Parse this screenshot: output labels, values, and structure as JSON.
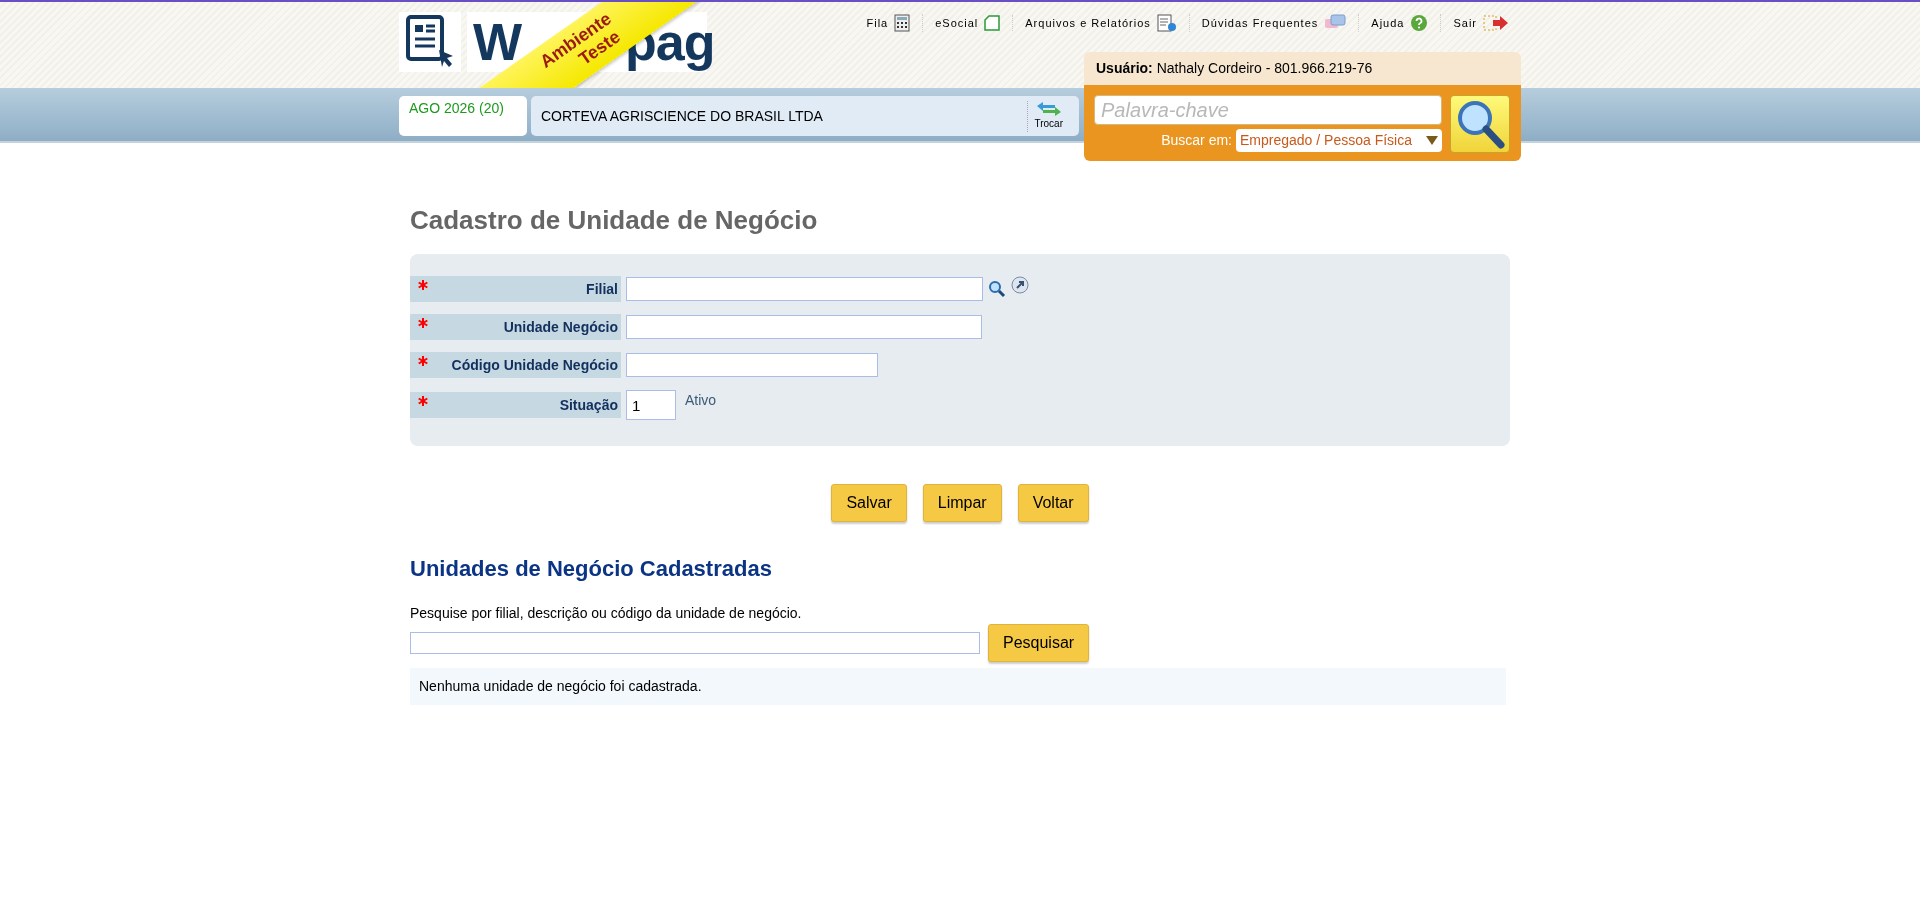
{
  "logo": {
    "parts": [
      "W",
      "pag"
    ]
  },
  "ribbon": {
    "lines": [
      "Ambiente",
      "Teste"
    ]
  },
  "top_nav": [
    {
      "label": "Fila",
      "kind": "calculator"
    },
    {
      "label": "eSocial",
      "kind": "document"
    },
    {
      "label": "Arquivos e Relatórios",
      "kind": "report"
    },
    {
      "label": "Dúvidas Frequentes",
      "kind": "chat"
    },
    {
      "label": "Ajuda",
      "kind": "help"
    },
    {
      "label": "Sair",
      "kind": "exit"
    }
  ],
  "user": {
    "label": "Usuário:",
    "value": "Nathaly Cordeiro - 801.966.219-76"
  },
  "search": {
    "placeholder": "Palavra-chave",
    "scope_label": "Buscar em:",
    "scope_value": "Empregado / Pessoa Física"
  },
  "period": "AGO 2026 (20)",
  "company": "CORTEVA AGRISCIENCE DO BRASIL LTDA",
  "switch_label": "Trocar",
  "form": {
    "title": "Cadastro de Unidade de Negócio",
    "fields": [
      {
        "label": "Filial",
        "required": true,
        "kind": "lookup"
      },
      {
        "label": "Unidade Negócio",
        "required": true,
        "kind": "text"
      },
      {
        "label": "Código Unidade Negócio",
        "required": true,
        "kind": "code"
      },
      {
        "label": "Situação",
        "required": true,
        "kind": "status",
        "value": "1",
        "description": "Ativo"
      }
    ]
  },
  "buttons": [
    "Salvar",
    "Limpar",
    "Voltar"
  ],
  "list": {
    "title": "Unidades de Negócio Cadastradas",
    "hint": "Pesquise por filial, descrição ou código da unidade de negócio.",
    "search_button": "Pesquisar",
    "empty_message": "Nenhuma unidade de negócio foi cadastrada."
  }
}
